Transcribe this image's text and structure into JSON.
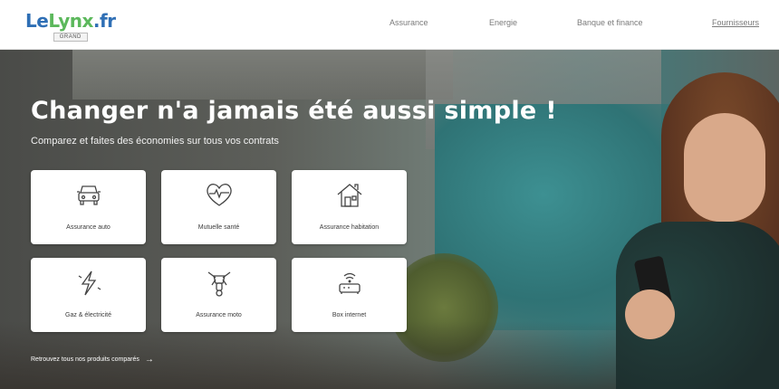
{
  "logo": {
    "part1": "Le",
    "part2": "Lynx",
    "part3": ".fr",
    "badge": "GRAND"
  },
  "nav": [
    {
      "label": "Assurance"
    },
    {
      "label": "Energie"
    },
    {
      "label": "Banque et finance"
    },
    {
      "label": "Fournisseurs"
    }
  ],
  "hero": {
    "title": "Changer n'a jamais été aussi simple !",
    "subtitle": "Comparez et faites des économies sur tous vos contrats"
  },
  "cards": [
    {
      "label": "Assurance auto",
      "icon": "car-icon"
    },
    {
      "label": "Mutuelle santé",
      "icon": "heart-pulse-icon"
    },
    {
      "label": "Assurance habitation",
      "icon": "house-icon"
    },
    {
      "label": "Gaz & électricité",
      "icon": "lightning-icon"
    },
    {
      "label": "Assurance moto",
      "icon": "moto-icon"
    },
    {
      "label": "Box internet",
      "icon": "router-icon"
    }
  ],
  "footer_link": {
    "label": "Retrouvez tous nos produits comparés",
    "arrow": "→"
  },
  "colors": {
    "logo_blue": "#2f6fb5",
    "logo_green": "#5cb85c",
    "card_bg": "#ffffff"
  }
}
